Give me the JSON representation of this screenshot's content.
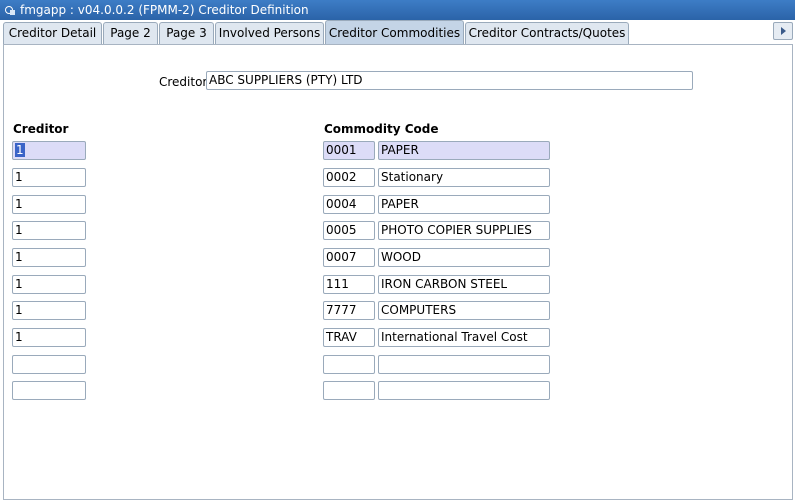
{
  "window": {
    "title": "fmgapp : v04.0.0.2  (FPMM-2) Creditor Definition"
  },
  "tabs": [
    {
      "label": "Creditor Detail"
    },
    {
      "label": "Page 2"
    },
    {
      "label": "Page 3"
    },
    {
      "label": "Involved Persons"
    },
    {
      "label": "Creditor Commodities",
      "active": true
    },
    {
      "label": "Creditor Contracts/Quotes"
    }
  ],
  "header": {
    "creditor_label": "Creditor",
    "creditor_value": "ABC SUPPLIERS (PTY) LTD"
  },
  "columns": {
    "creditor": "Creditor",
    "commodity_code": "Commodity Code"
  },
  "rows": [
    {
      "creditor": "1",
      "code": "0001",
      "description": "PAPER"
    },
    {
      "creditor": "1",
      "code": "0002",
      "description": "Stationary"
    },
    {
      "creditor": "1",
      "code": "0004",
      "description": "PAPER"
    },
    {
      "creditor": "1",
      "code": "0005",
      "description": "PHOTO COPIER SUPPLIES"
    },
    {
      "creditor": "1",
      "code": "0007",
      "description": "WOOD"
    },
    {
      "creditor": "1",
      "code": "111",
      "description": "IRON CARBON STEEL"
    },
    {
      "creditor": "1",
      "code": "7777",
      "description": "COMPUTERS"
    },
    {
      "creditor": "1",
      "code": "TRAV",
      "description": "International Travel Cost"
    },
    {
      "creditor": "",
      "code": "",
      "description": ""
    },
    {
      "creditor": "",
      "code": "",
      "description": ""
    }
  ],
  "icons": {
    "app": "app-icon",
    "tab_scroll": "arrow-right-icon"
  },
  "colors": {
    "titlebar": "#2b63a8",
    "highlight": "#dcdcf7",
    "selection": "#3a64c7"
  }
}
